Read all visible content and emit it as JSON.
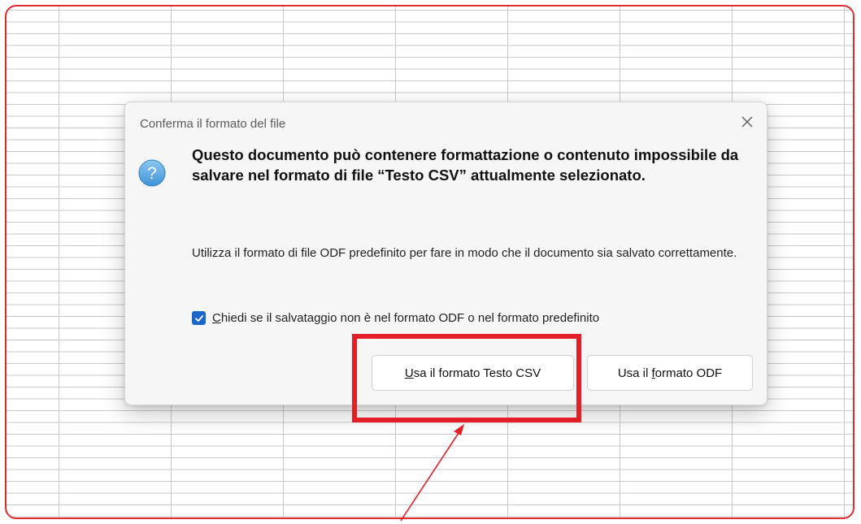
{
  "dialog": {
    "title": "Conferma il formato del file",
    "heading": "Questo documento può contenere formattazione o contenuto impossibile da salvare nel formato di file “Testo CSV” attualmente selezionato.",
    "message": "Utilizza il formato di file ODF predefinito per fare in modo che il documento sia salvato correttamente.",
    "checkbox": {
      "checked": true,
      "label_first": "C",
      "label_rest": "hiedi se il salvataggio non è nel formato ODF o nel formato predefinito"
    },
    "buttons": {
      "keep_csv": {
        "mnemonic": "U",
        "rest": "sa il formato Testo CSV"
      },
      "use_odf": {
        "before": "Usa il ",
        "mnemonic": "f",
        "after": "ormato ODF"
      }
    },
    "icons": {
      "close": "close-icon",
      "question": "question-icon"
    }
  },
  "colors": {
    "highlight": "#e21f26",
    "accent": "#1b66c9"
  }
}
